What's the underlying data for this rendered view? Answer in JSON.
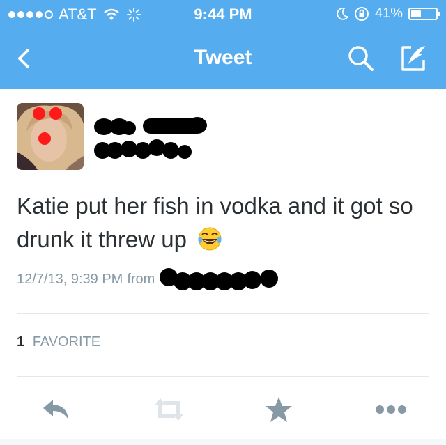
{
  "status_bar": {
    "carrier": "AT&T",
    "time": "9:44 PM",
    "battery": "41%",
    "battery_level": 0.41,
    "signal_bars": 4,
    "signal_max": 5
  },
  "nav": {
    "title": "Tweet"
  },
  "tweet": {
    "text": "Katie put her fish in vodka and it got so drunk it threw up",
    "timestamp": "12/7/13, 9:39 PM",
    "from_label": "from"
  },
  "stats": {
    "favorite_count": "1",
    "favorite_label": "FAVORITE"
  },
  "colors": {
    "brand_blue": "#55acee",
    "action_gray": "#8899a6",
    "text_dark": "#292f33"
  },
  "icons": [
    "back-icon",
    "search-icon",
    "compose-icon",
    "reply-icon",
    "retweet-icon",
    "favorite-icon",
    "more-icon"
  ]
}
